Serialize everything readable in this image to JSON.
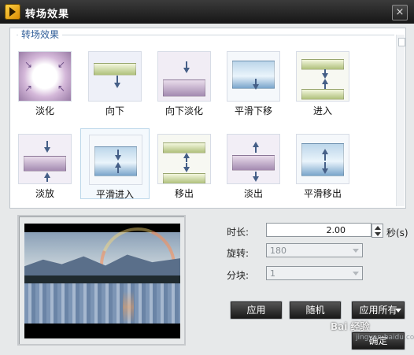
{
  "window": {
    "title": "转场效果",
    "close_symbol": "×"
  },
  "effects_group": {
    "title": "转场效果"
  },
  "effects": [
    {
      "label": "淡化"
    },
    {
      "label": "向下"
    },
    {
      "label": "向下淡化"
    },
    {
      "label": "平滑下移"
    },
    {
      "label": "进入"
    },
    {
      "label": "淡放"
    },
    {
      "label": "平滑进入",
      "selected": true
    },
    {
      "label": "移出"
    },
    {
      "label": "淡出"
    },
    {
      "label": "平滑移出"
    }
  ],
  "settings": {
    "duration_label": "时长:",
    "duration_value": "2.00",
    "duration_suffix": "秒(s)",
    "rotation_label": "旋转:",
    "rotation_value": "180",
    "blocks_label": "分块:",
    "blocks_value": "1"
  },
  "buttons": {
    "apply": "应用",
    "random": "随机",
    "apply_all": "应用所有",
    "ok": "确定"
  },
  "watermark": {
    "text": "Bai 经验",
    "sub": "jingyan.baidu.com"
  }
}
